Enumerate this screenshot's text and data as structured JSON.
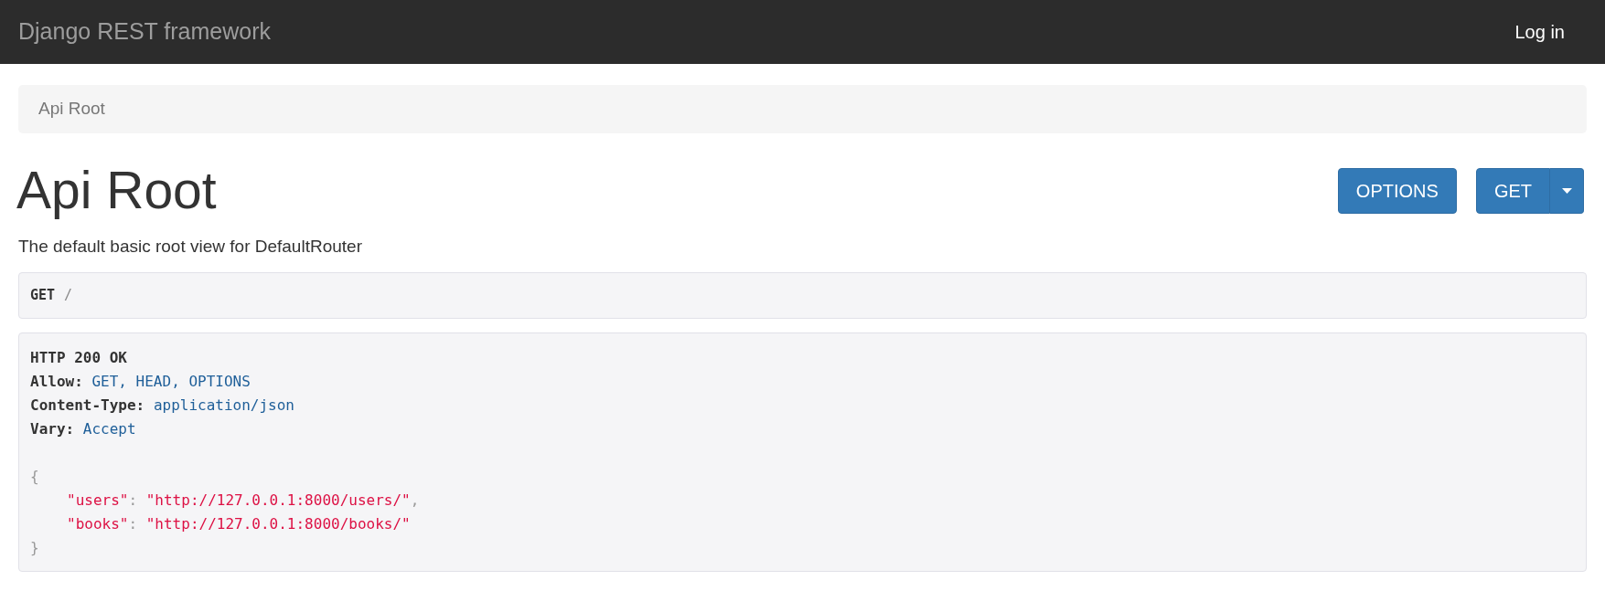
{
  "navbar": {
    "brand": "Django REST framework",
    "login": "Log in"
  },
  "breadcrumb": {
    "items": [
      "Api Root"
    ]
  },
  "title": "Api Root",
  "actions": {
    "options": "OPTIONS",
    "get": "GET"
  },
  "description": "The default basic root view for DefaultRouter",
  "request": {
    "method": "GET",
    "path": "/"
  },
  "response": {
    "status": "HTTP 200 OK",
    "headers": [
      {
        "name": "Allow:",
        "value": "GET, HEAD, OPTIONS"
      },
      {
        "name": "Content-Type:",
        "value": "application/json"
      },
      {
        "name": "Vary:",
        "value": "Accept"
      }
    ],
    "body_open": "{",
    "body": [
      {
        "key": "\"users\"",
        "separator": ":",
        "value": "\"http://127.0.0.1:8000/users/\"",
        "trailing": ","
      },
      {
        "key": "\"books\"",
        "separator": ":",
        "value": "\"http://127.0.0.1:8000/books/\""
      }
    ],
    "body_close": "}"
  }
}
